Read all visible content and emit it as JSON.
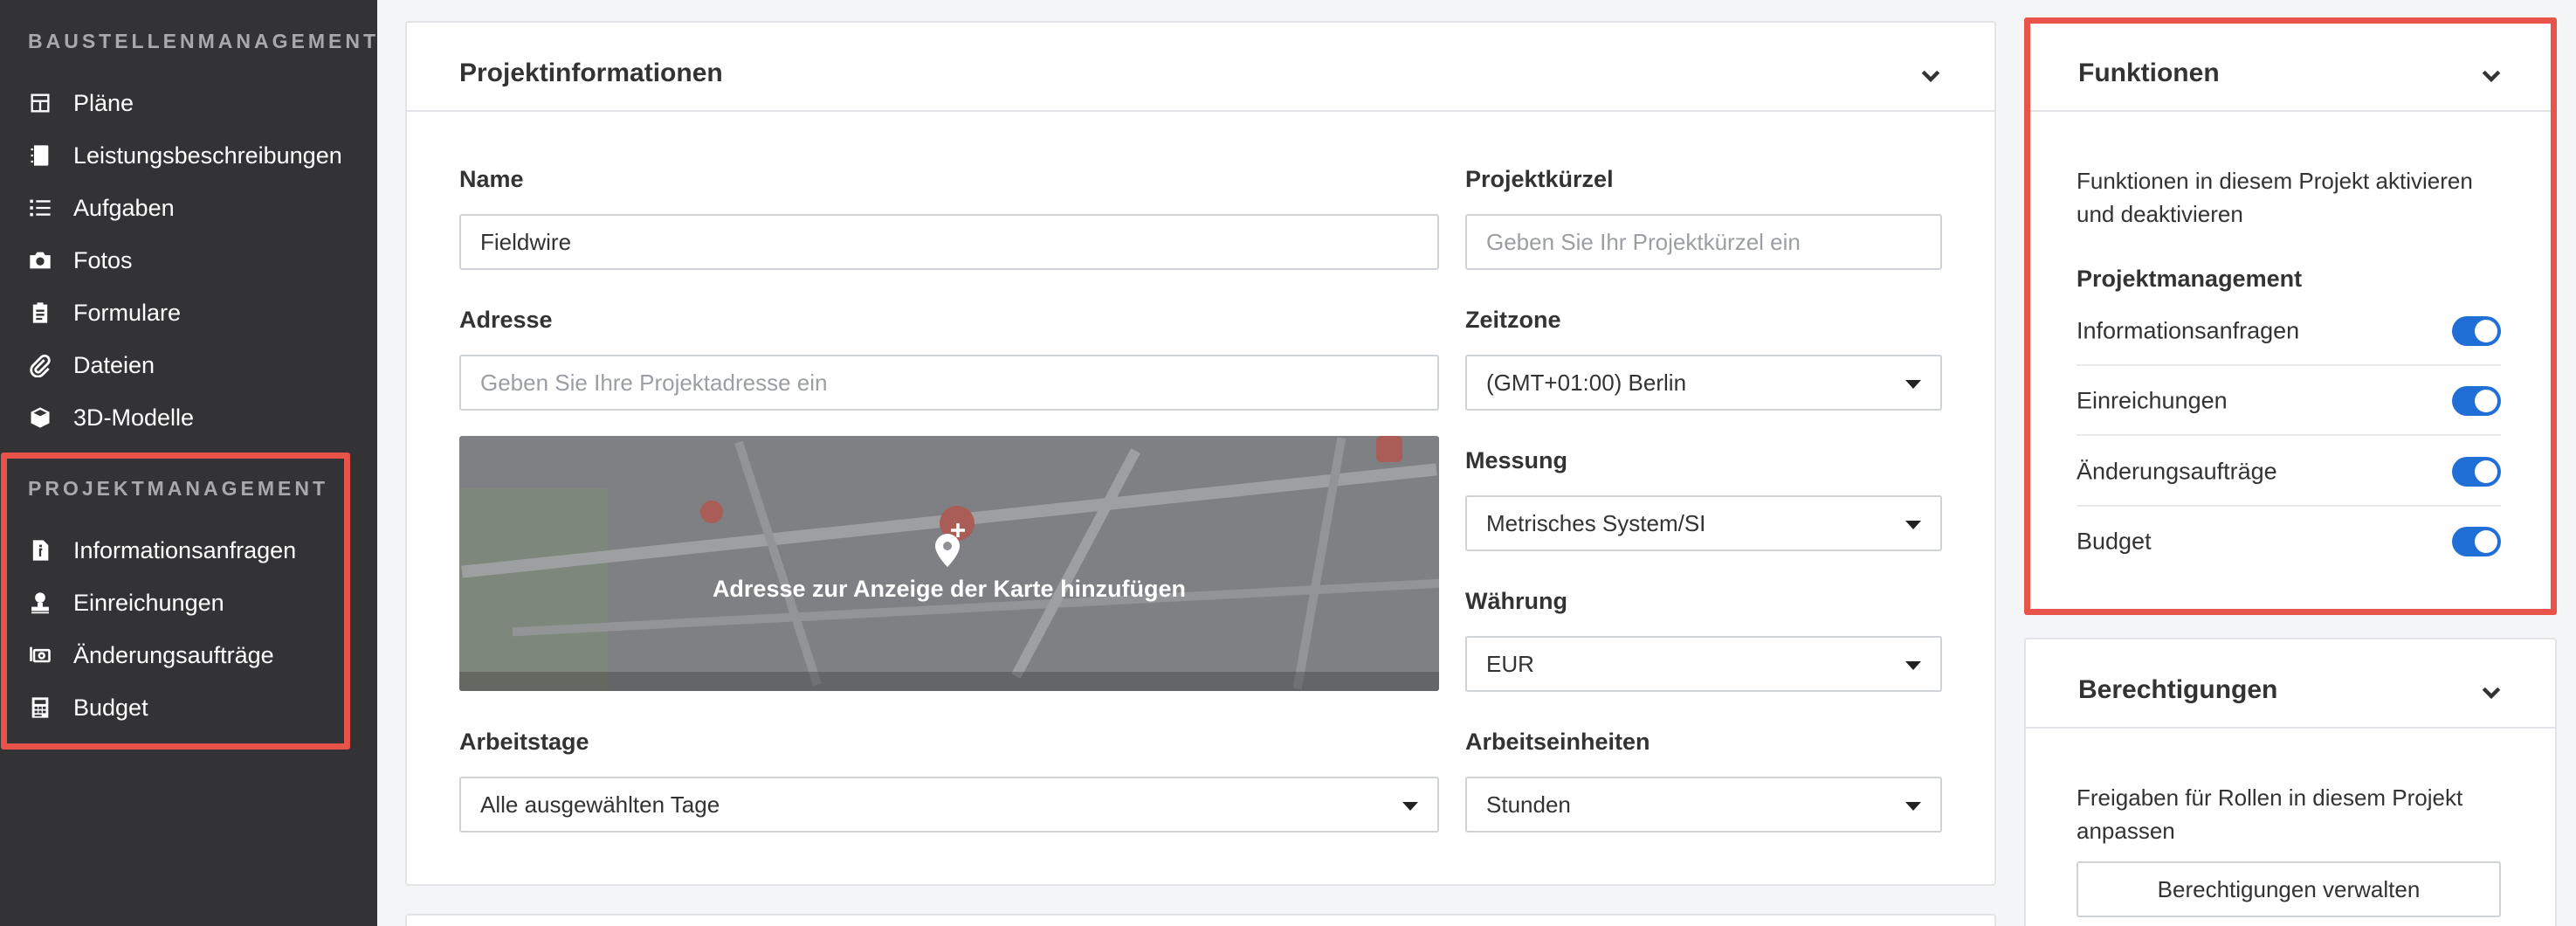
{
  "sidebar": {
    "section_baustellen": "BAUSTELLENMANAGEMENT",
    "baustellen_items": [
      {
        "label": "Pläne",
        "icon": "plans-icon"
      },
      {
        "label": "Leistungsbeschreibungen",
        "icon": "notebook-icon"
      },
      {
        "label": "Aufgaben",
        "icon": "list-icon"
      },
      {
        "label": "Fotos",
        "icon": "camera-icon"
      },
      {
        "label": "Formulare",
        "icon": "clipboard-icon"
      },
      {
        "label": "Dateien",
        "icon": "paperclip-icon"
      },
      {
        "label": "3D-Modelle",
        "icon": "cube-icon"
      }
    ],
    "section_projekt": "PROJEKTMANAGEMENT",
    "projekt_items": [
      {
        "label": "Informationsanfragen",
        "icon": "file-info-icon"
      },
      {
        "label": "Einreichungen",
        "icon": "user-stamp-icon"
      },
      {
        "label": "Änderungsaufträge",
        "icon": "money-change-icon"
      },
      {
        "label": "Budget",
        "icon": "calculator-icon"
      }
    ]
  },
  "project_info": {
    "title": "Projektinformationen",
    "name_label": "Name",
    "name_value": "Fieldwire",
    "kuerzel_label": "Projektkürzel",
    "kuerzel_placeholder": "Geben Sie Ihr Projektkürzel ein",
    "address_label": "Adresse",
    "address_placeholder": "Geben Sie Ihre Projektadresse ein",
    "timezone_label": "Zeitzone",
    "timezone_value": "(GMT+01:00) Berlin",
    "map_text": "Adresse zur Anzeige der Karte hinzufügen",
    "measure_label": "Messung",
    "measure_value": "Metrisches System/SI",
    "currency_label": "Währung",
    "currency_value": "EUR",
    "workdays_label": "Arbeitstage",
    "workdays_value": "Alle ausgewählten Tage",
    "workunits_label": "Arbeitseinheiten",
    "workunits_value": "Stunden"
  },
  "functions": {
    "title": "Funktionen",
    "description": "Funktionen in diesem Projekt aktivieren und deaktivieren",
    "subheading": "Projektmanagement",
    "toggles": [
      {
        "label": "Informationsanfragen",
        "enabled": true
      },
      {
        "label": "Einreichungen",
        "enabled": true
      },
      {
        "label": "Änderungsaufträge",
        "enabled": true
      },
      {
        "label": "Budget",
        "enabled": true
      }
    ]
  },
  "permissions": {
    "title": "Berechtigungen",
    "description": "Freigaben für Rollen in diesem Projekt anpassen",
    "button_label": "Berechtigungen verwalten"
  },
  "colors": {
    "sidebar_bg": "#333335",
    "toggle_on": "#1f6fd6",
    "highlight": "#e8544a"
  }
}
